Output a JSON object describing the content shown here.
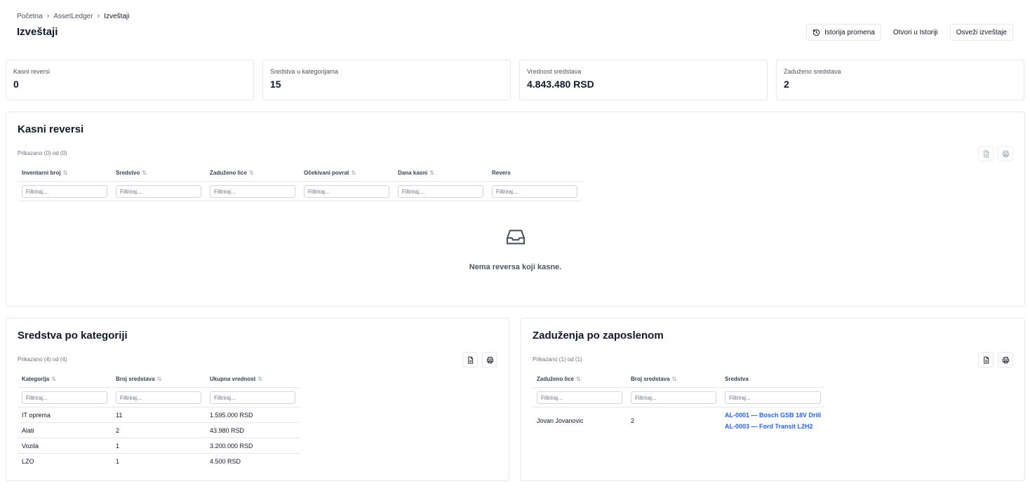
{
  "breadcrumb": [
    "Početna",
    "AssetLedger",
    "Izveštaji"
  ],
  "page_title": "Izveštaji",
  "actions": {
    "history": "Istorija promena",
    "open_history": "Otvori u Istoriji",
    "refresh": "Osveži izveštaje"
  },
  "stats": [
    {
      "label": "Kasni reversi",
      "value": "0"
    },
    {
      "label": "Sredstva u kategorijama",
      "value": "15"
    },
    {
      "label": "Vrednost sredstava",
      "value": "4.843.480 RSD"
    },
    {
      "label": "Zaduženo sredstava",
      "value": "2"
    }
  ],
  "filter_placeholder": "Filtriraj...",
  "late": {
    "title": "Kasni reversi",
    "shown": "Prikazano (0) od (0)",
    "columns": [
      "Inventarni broj",
      "Sredstvo",
      "Zaduženo lice",
      "Očekivani povrat",
      "Dana kasni",
      "Revers"
    ],
    "empty_text": "Nema reversa koji kasne."
  },
  "by_category": {
    "title": "Sredstva po kategoriji",
    "shown": "Prikazano (4) od (4)",
    "columns": [
      "Kategorija",
      "Broj sredstava",
      "Ukupna vrednost"
    ],
    "rows": [
      [
        "IT oprema",
        "11",
        "1.595.000 RSD"
      ],
      [
        "Alati",
        "2",
        "43.980 RSD"
      ],
      [
        "Vozila",
        "1",
        "3.200.000 RSD"
      ],
      [
        "LZO",
        "1",
        "4.500 RSD"
      ]
    ]
  },
  "by_employee": {
    "title": "Zaduženja po zaposlenom",
    "shown": "Prikazano (1) od (1)",
    "columns": [
      "Zaduženo lice",
      "Broj sredstava",
      "Sredstva"
    ],
    "rows": [
      {
        "person": "Jovan Jovanovic",
        "count": "2",
        "assets": [
          "AL-0001 — Bosch GSB 18V Drill",
          "AL-0003 — Ford Transit L2H2"
        ]
      }
    ]
  }
}
